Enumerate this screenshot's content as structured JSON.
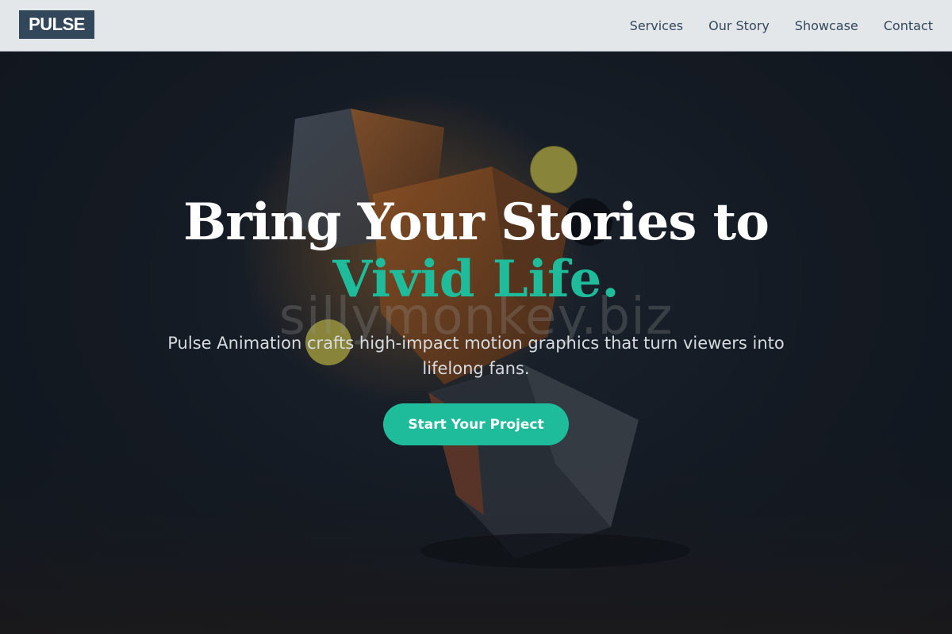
{
  "brand": {
    "logo_text": "PULSE",
    "accent_color": "#1fbc9c",
    "logo_bg": "#33475b"
  },
  "nav": {
    "items": [
      {
        "label": "Services"
      },
      {
        "label": "Our Story"
      },
      {
        "label": "Showcase"
      },
      {
        "label": "Contact"
      }
    ]
  },
  "hero": {
    "headline_line1": "Bring Your Stories to",
    "headline_accent": "Vivid Life.",
    "subtext": "Pulse Animation crafts high-impact motion graphics that turn viewers into lifelong fans.",
    "cta_label": "Start Your Project",
    "watermark": "sillymonkey.biz",
    "background_image": "3d-cubes-and-spheres-image"
  }
}
